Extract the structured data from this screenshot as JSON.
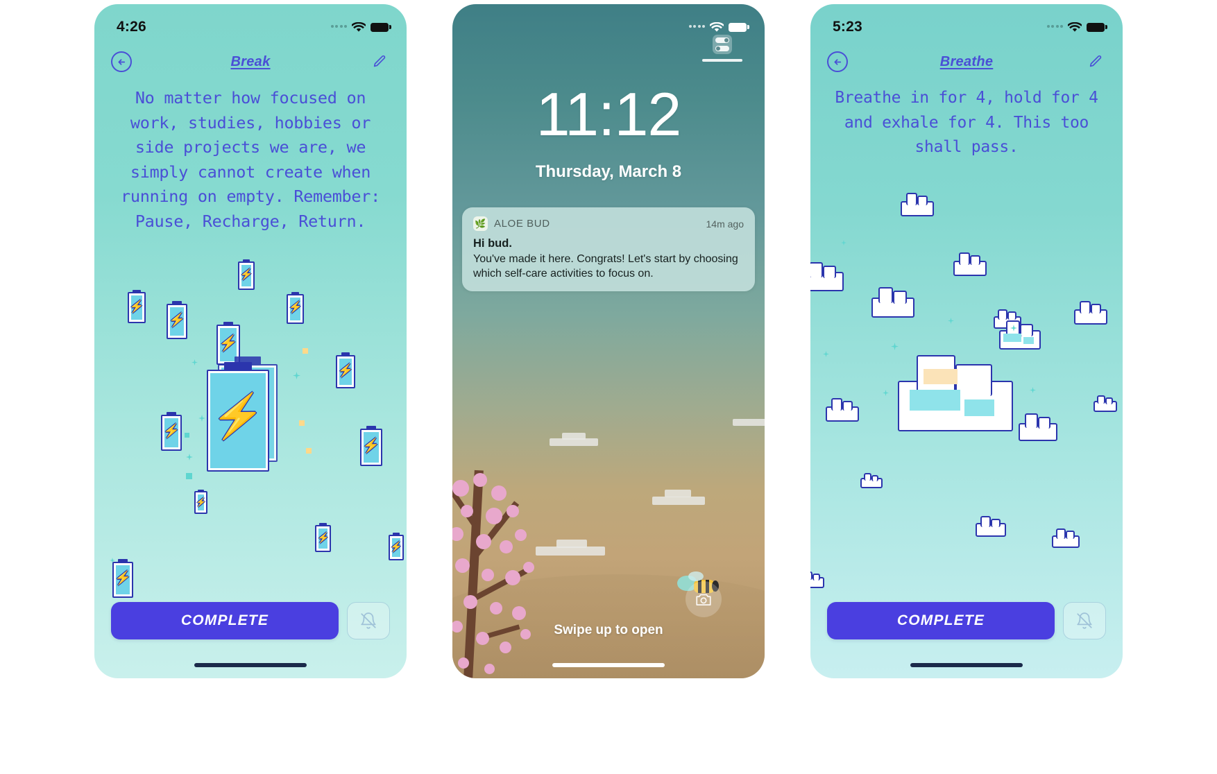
{
  "panels": {
    "break": {
      "status": {
        "time": "4:26",
        "wifi_icon": "wifi-icon",
        "battery_icon": "battery-icon",
        "signal_icon": "signal-dots-icon"
      },
      "nav": {
        "back_icon": "back-arrow-icon",
        "title": "Break",
        "edit_icon": "pencil-icon"
      },
      "prompt": "No matter how focused on work, studies, hobbies or side projects we are, we simply cannot create when running on empty. Remember: Pause, Recharge, Return.",
      "artwork": "battery-pixel-art",
      "complete_label": "COMPLETE",
      "mute_icon": "bell-slash-icon"
    },
    "lockscreen": {
      "status": {
        "wifi_icon": "wifi-icon",
        "battery_icon": "battery-icon",
        "signal_icon": "signal-dots-icon"
      },
      "time": "11:12",
      "date": "Thursday, March 8",
      "notification": {
        "app_icon": "aloe-bud-app-icon",
        "app_name": "ALOE BUD",
        "time_ago": "14m ago",
        "title": "Hi bud.",
        "body": "You've made it here. Congrats! Let's start by choosing which self-care activities to focus on."
      },
      "swipe_hint": "Swipe up to open",
      "camera_icon": "camera-icon",
      "controls_icon": "toggle-controls-icon"
    },
    "breathe": {
      "status": {
        "time": "5:23",
        "wifi_icon": "wifi-icon",
        "battery_icon": "battery-icon",
        "signal_icon": "signal-dots-icon"
      },
      "nav": {
        "back_icon": "back-arrow-icon",
        "title": "Breathe",
        "edit_icon": "pencil-icon"
      },
      "prompt": "Breathe in for 4, hold for 4 and exhale for 4. This too shall pass.",
      "artwork": "cloud-pixel-art",
      "complete_label": "COMPLETE",
      "mute_icon": "bell-slash-icon"
    }
  },
  "colors": {
    "accent_purple": "#4a3fe0",
    "nav_blue": "#4a4fd6",
    "aloe_teal_top": "#7fd6cc",
    "aloe_teal_bottom": "#c9f0ec",
    "lock_sky": "#3f7f86",
    "lock_ground": "#ad8f67",
    "notification_bg": "#c6e2de"
  }
}
